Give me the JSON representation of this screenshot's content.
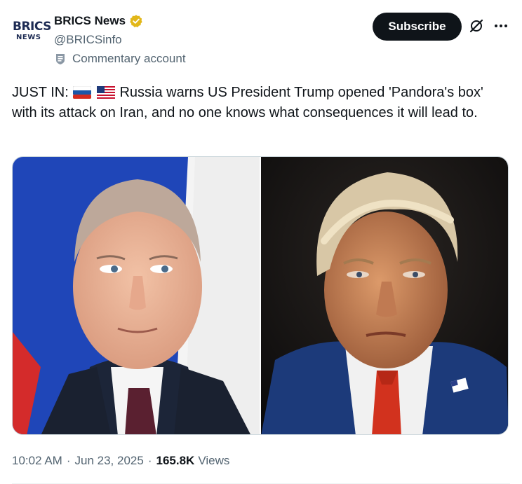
{
  "account": {
    "avatar_text_top": "BRICS",
    "avatar_text_bottom": "NEWS",
    "display_name": "BRICS News",
    "handle": "@BRICSinfo",
    "label": "Commentary account",
    "verified_color": "#e2b719"
  },
  "actions": {
    "subscribe_label": "Subscribe"
  },
  "tweet": {
    "prefix": "JUST IN:",
    "flags": [
      "russia-flag",
      "us-flag"
    ],
    "body": "Russia warns US President Trump opened 'Pandora's box' with its attack on Iran, and no one knows what consequences it will lead to."
  },
  "media": {
    "images": [
      {
        "subject": "Vladimir Putin portrait",
        "background": "Russian flag"
      },
      {
        "subject": "Donald Trump portrait",
        "background": "dark"
      }
    ]
  },
  "meta": {
    "time": "10:02 AM",
    "date": "Jun 23, 2025",
    "views_count": "165.8K",
    "views_label": "Views"
  },
  "colors": {
    "text": "#0f1419",
    "secondary": "#536471",
    "button_bg": "#0f1419",
    "border": "#cfd9de"
  }
}
